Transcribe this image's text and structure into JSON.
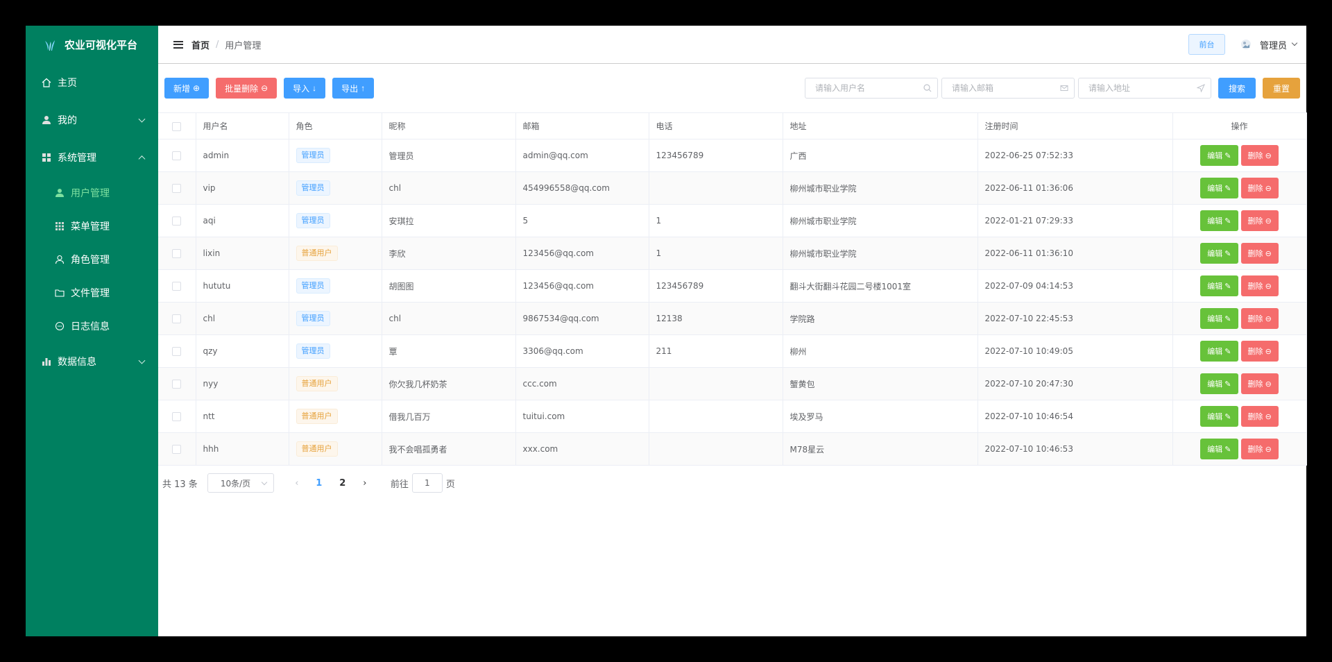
{
  "app": {
    "title": "农业可视化平台"
  },
  "sidebar": {
    "items": [
      {
        "label": "主页"
      },
      {
        "label": "我的"
      },
      {
        "label": "系统管理"
      },
      {
        "label": "数据信息"
      }
    ],
    "sub_items": [
      {
        "label": "用户管理"
      },
      {
        "label": "菜单管理"
      },
      {
        "label": "角色管理"
      },
      {
        "label": "文件管理"
      },
      {
        "label": "日志信息"
      }
    ]
  },
  "header": {
    "breadcrumb_home": "首页",
    "breadcrumb_sep": "/",
    "breadcrumb_current": "用户管理",
    "front_button": "前台",
    "user_name": "管理员"
  },
  "toolbar": {
    "add": "新增",
    "batch_delete": "批量删除",
    "import": "导入",
    "export": "导出",
    "search_username_placeholder": "请输入用户名",
    "search_email_placeholder": "请输入邮箱",
    "search_address_placeholder": "请输入地址",
    "search": "搜索",
    "reset": "重置"
  },
  "table": {
    "headers": [
      "用户名",
      "角色",
      "昵称",
      "邮箱",
      "电话",
      "地址",
      "注册时间",
      "操作"
    ],
    "edit_label": "编辑",
    "delete_label": "删除",
    "rows": [
      {
        "username": "admin",
        "role": "管理员",
        "role_type": "admin",
        "nickname": "管理员",
        "email": "admin@qq.com",
        "phone": "123456789",
        "address": "广西",
        "created": "2022-06-25 07:52:33"
      },
      {
        "username": "vip",
        "role": "管理员",
        "role_type": "admin",
        "nickname": "chl",
        "email": "454996558@qq.com",
        "phone": "",
        "address": "柳州城市职业学院",
        "created": "2022-06-11 01:36:06"
      },
      {
        "username": "aqi",
        "role": "管理员",
        "role_type": "admin",
        "nickname": "安琪拉",
        "email": "5",
        "phone": "1",
        "address": "柳州城市职业学院",
        "created": "2022-01-21 07:29:33"
      },
      {
        "username": "lixin",
        "role": "普通用户",
        "role_type": "user",
        "nickname": "李欣",
        "email": "123456@qq.com",
        "phone": "1",
        "address": "柳州城市职业学院",
        "created": "2022-06-11 01:36:10"
      },
      {
        "username": "hututu",
        "role": "管理员",
        "role_type": "admin",
        "nickname": "胡图图",
        "email": "123456@qq.com",
        "phone": "123456789",
        "address": "翻斗大街翻斗花园二号楼1001室",
        "created": "2022-07-09 04:14:53"
      },
      {
        "username": "chl",
        "role": "管理员",
        "role_type": "admin",
        "nickname": "chl",
        "email": "9867534@qq.com",
        "phone": "12138",
        "address": "学院路",
        "created": "2022-07-10 22:45:53"
      },
      {
        "username": "qzy",
        "role": "管理员",
        "role_type": "admin",
        "nickname": "覃",
        "email": "3306@qq.com",
        "phone": "211",
        "address": "柳州",
        "created": "2022-07-10 10:49:05"
      },
      {
        "username": "nyy",
        "role": "普通用户",
        "role_type": "user",
        "nickname": "你欠我几杯奶茶",
        "email": "ccc.com",
        "phone": "",
        "address": "蟹黄包",
        "created": "2022-07-10 20:47:30"
      },
      {
        "username": "ntt",
        "role": "普通用户",
        "role_type": "user",
        "nickname": "借我几百万",
        "email": "tuitui.com",
        "phone": "",
        "address": "埃及罗马",
        "created": "2022-07-10 10:46:54"
      },
      {
        "username": "hhh",
        "role": "普通用户",
        "role_type": "user",
        "nickname": "我不会唱孤勇者",
        "email": "xxx.com",
        "phone": "",
        "address": "M78星云",
        "created": "2022-07-10 10:46:53"
      }
    ]
  },
  "pagination": {
    "total": "共 13 条",
    "page_size": "10条/页",
    "pages": [
      "1",
      "2"
    ],
    "current": "1",
    "goto_label": "前往",
    "goto_value": "1",
    "page_unit": "页"
  },
  "colors": {
    "sidebar_bg": "#008060",
    "primary": "#409eff",
    "danger": "#f56c6c",
    "warning": "#e6a23c",
    "success": "#67c23a"
  }
}
